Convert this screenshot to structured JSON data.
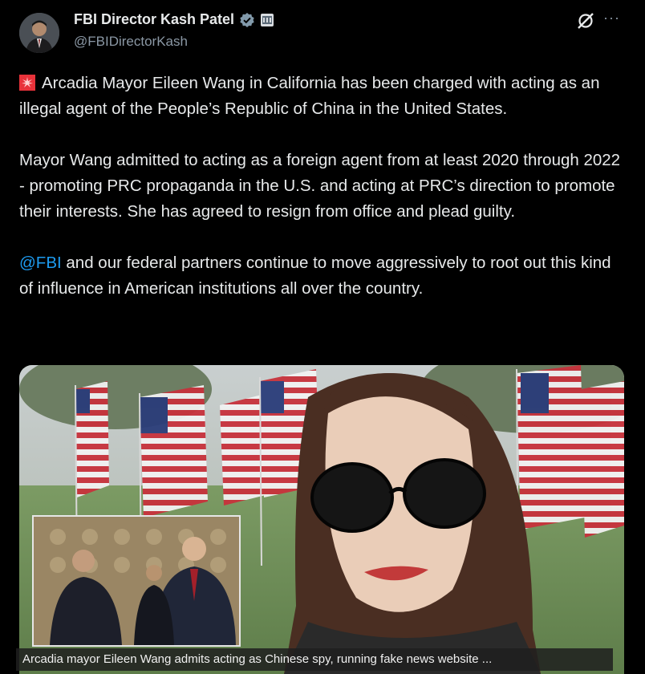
{
  "author": {
    "name": "FBI Director Kash Patel",
    "handle": "@FBIDirectorKash"
  },
  "icons": {
    "avatar": "avatar",
    "verified": "verified-badge-icon",
    "gov": "government-badge-icon",
    "grok": "grok-icon",
    "more": "more-icon",
    "alert": "rotating-light-emoji-icon"
  },
  "colors": {
    "background": "#000000",
    "text": "#e7e9ea",
    "secondary": "#8b98a5",
    "link": "#1d9bf0",
    "verified": "#829aab"
  },
  "more_label": "···",
  "tweet": {
    "paragraph1": "Arcadia Mayor Eileen Wang in California has been charged with acting as an illegal agent of the People’s Republic of China in the United States.",
    "paragraph2": "Mayor Wang admitted to acting as a foreign agent from at least 2020 through 2022 - promoting PRC propaganda in the U.S. and acting at PRC’s direction to promote their interests. She has agreed to resign from office and plead guilty.",
    "mention": "@FBI",
    "paragraph3_rest": " and our federal partners continue to move aggressively to root out this kind of influence in American institutions all over the country."
  },
  "media": {
    "caption": "Arcadia mayor Eileen Wang admits acting as Chinese spy, running fake news website ..."
  }
}
